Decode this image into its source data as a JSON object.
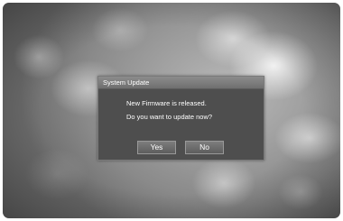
{
  "dialog": {
    "title": "System Update",
    "message_line1": "New Firmware is released.",
    "message_line2": "Do you want to update now?",
    "buttons": {
      "yes_label": "Yes",
      "no_label": "No"
    }
  }
}
